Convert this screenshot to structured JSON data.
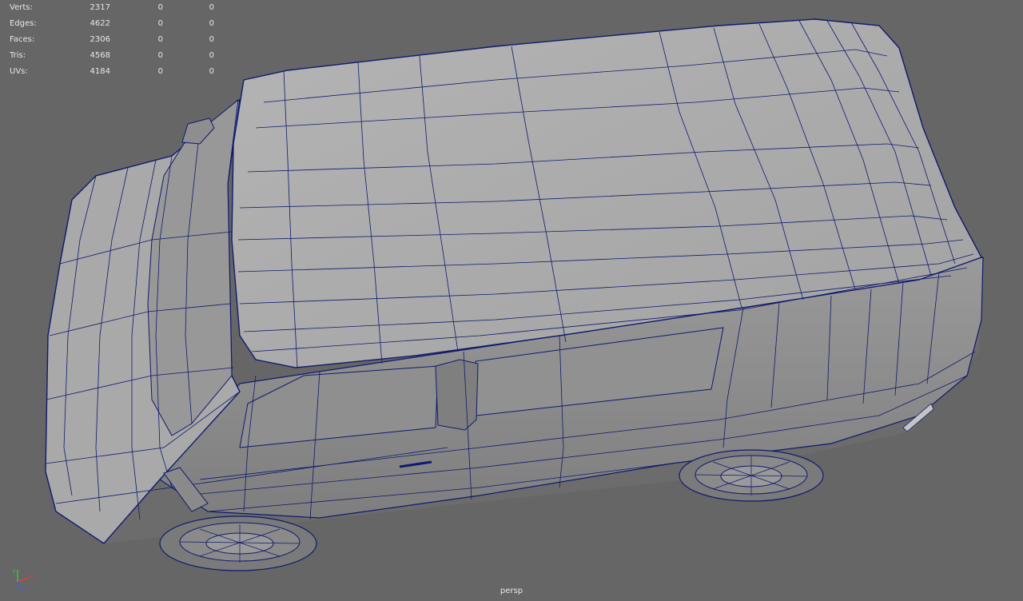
{
  "hud": {
    "rows": [
      {
        "label": "Verts:",
        "v1": "2317",
        "v2": "0",
        "v3": "0"
      },
      {
        "label": "Edges:",
        "v1": "4622",
        "v2": "0",
        "v3": "0"
      },
      {
        "label": "Faces:",
        "v1": "2306",
        "v2": "0",
        "v3": "0"
      },
      {
        "label": "Tris:",
        "v1": "4568",
        "v2": "0",
        "v3": "0"
      },
      {
        "label": "UVs:",
        "v1": "4184",
        "v2": "0",
        "v3": "0"
      }
    ]
  },
  "viewport": {
    "camera": "persp",
    "background_color": "#666666",
    "wire_color": "#101a6e",
    "surface_color": "#a6a6a6"
  },
  "gizmo": {
    "x_label": "x",
    "y_label": "y",
    "z_label": "z"
  }
}
